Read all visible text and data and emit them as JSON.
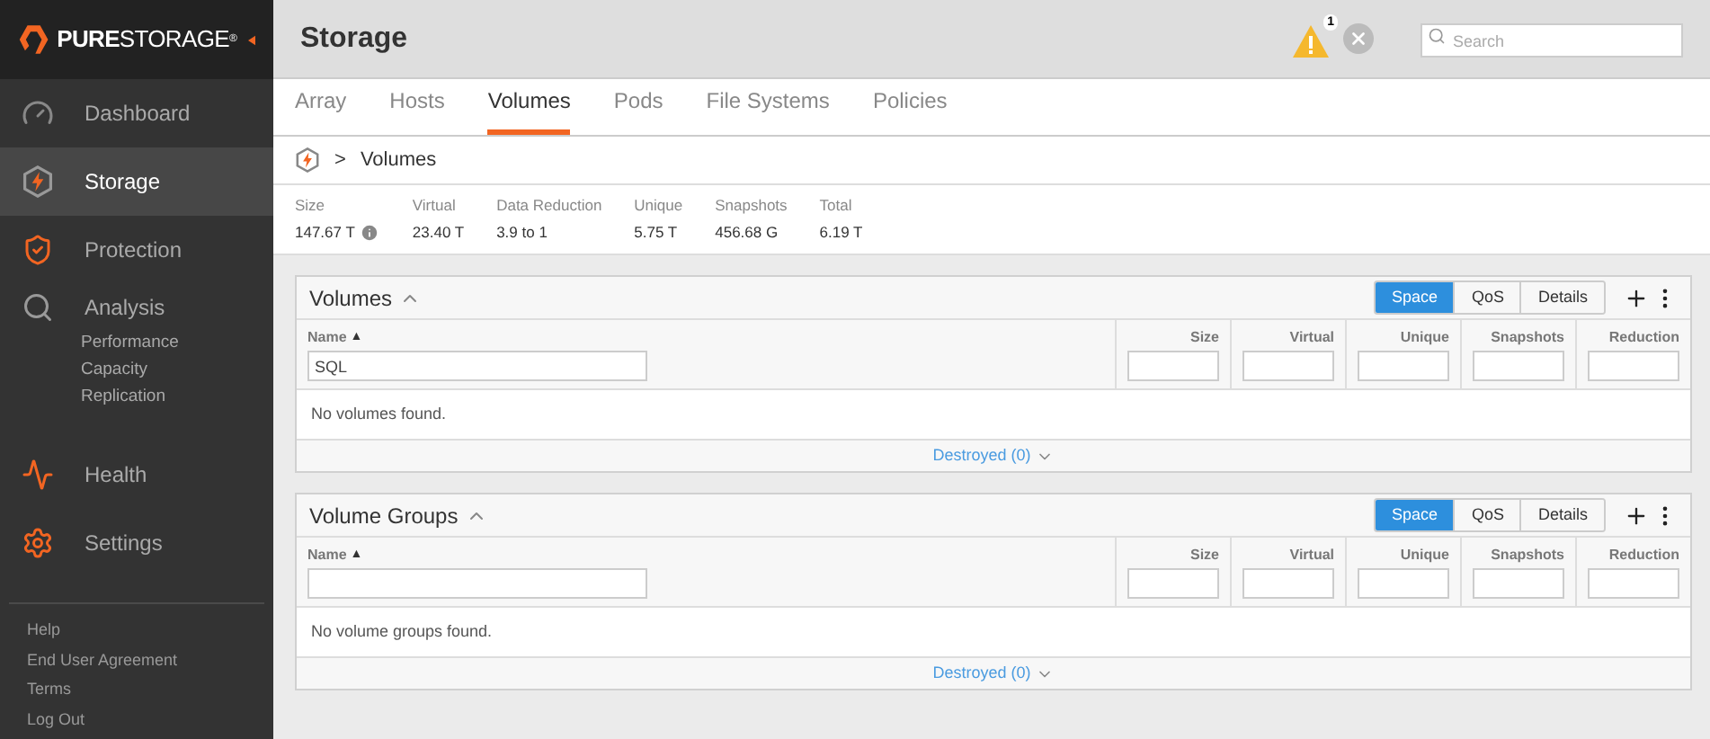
{
  "brand": {
    "bold": "PURE",
    "light": "STORAGE",
    "mark": "®"
  },
  "sidebar": {
    "items": [
      {
        "label": "Dashboard",
        "kind": "gauge",
        "selected": false
      },
      {
        "label": "Storage",
        "kind": "storage",
        "selected": true
      },
      {
        "label": "Protection",
        "kind": "shield",
        "selected": false
      },
      {
        "label": "Analysis",
        "kind": "analysis",
        "selected": false,
        "children": [
          {
            "label": "Performance"
          },
          {
            "label": "Capacity"
          },
          {
            "label": "Replication"
          }
        ]
      },
      {
        "label": "Health",
        "kind": "health",
        "selected": false
      },
      {
        "label": "Settings",
        "kind": "settings",
        "selected": false
      }
    ],
    "footer_links": [
      "Help",
      "End User Agreement",
      "Terms",
      "Log Out"
    ]
  },
  "header": {
    "title": "Storage",
    "alert_count": "1",
    "search": {
      "placeholder": "Search"
    }
  },
  "tabs": [
    {
      "label": "Array",
      "selected": false
    },
    {
      "label": "Hosts",
      "selected": false
    },
    {
      "label": "Volumes",
      "selected": true
    },
    {
      "label": "Pods",
      "selected": false
    },
    {
      "label": "File Systems",
      "selected": false
    },
    {
      "label": "Policies",
      "selected": false
    }
  ],
  "breadcrumb": {
    "separator": ">",
    "current": "Volumes"
  },
  "stats": [
    {
      "label": "Size",
      "value": "147.67 T",
      "info": true
    },
    {
      "label": "Virtual",
      "value": "23.40 T",
      "info": false
    },
    {
      "label": "Data Reduction",
      "value": "3.9 to 1",
      "info": false
    },
    {
      "label": "Unique",
      "value": "5.75 T",
      "info": false
    },
    {
      "label": "Snapshots",
      "value": "456.68 G",
      "info": false
    },
    {
      "label": "Total",
      "value": "6.19 T",
      "info": false
    }
  ],
  "panels": [
    {
      "title": "Volumes",
      "views": [
        {
          "label": "Space",
          "selected": true
        },
        {
          "label": "QoS",
          "selected": false
        },
        {
          "label": "Details",
          "selected": false
        }
      ],
      "sort_mark": "▲",
      "columns": [
        {
          "label": "Name",
          "filter": "SQL"
        },
        {
          "label": "Size"
        },
        {
          "label": "Virtual"
        },
        {
          "label": "Unique"
        },
        {
          "label": "Snapshots"
        },
        {
          "label": "Reduction"
        }
      ],
      "empty_message": "No volumes found.",
      "destroyed": "Destroyed (0)"
    },
    {
      "title": "Volume Groups",
      "views": [
        {
          "label": "Space",
          "selected": true
        },
        {
          "label": "QoS",
          "selected": false
        },
        {
          "label": "Details",
          "selected": false
        }
      ],
      "sort_mark": "▲",
      "columns": [
        {
          "label": "Name"
        },
        {
          "label": "Size"
        },
        {
          "label": "Virtual"
        },
        {
          "label": "Unique"
        },
        {
          "label": "Snapshots"
        },
        {
          "label": "Reduction"
        }
      ],
      "empty_message": "No volume groups found.",
      "destroyed": "Destroyed (0)"
    }
  ]
}
